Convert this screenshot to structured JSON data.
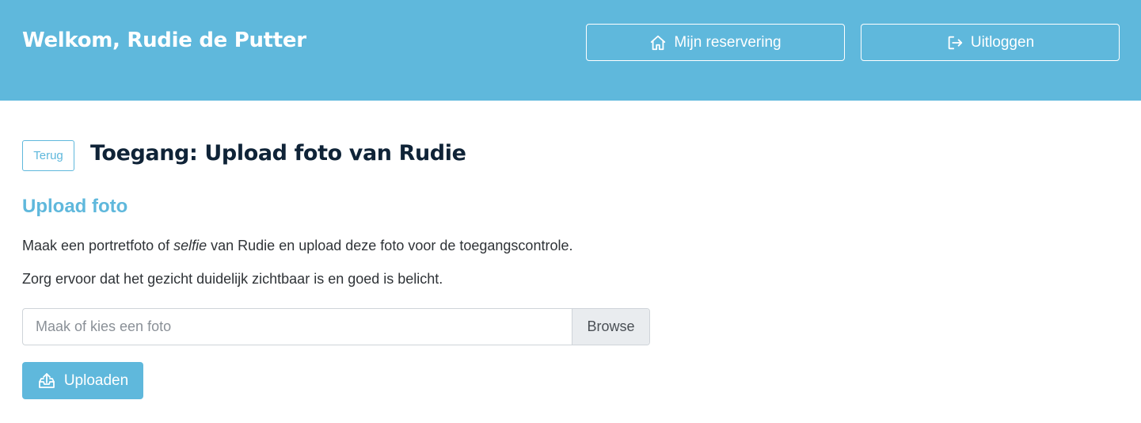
{
  "header": {
    "welcome": "Welkom, Rudie de Putter",
    "reservation_label": "Mijn reservering",
    "logout_label": "Uitloggen",
    "reservation_icon": "home-icon",
    "logout_icon": "logout-icon"
  },
  "page": {
    "back_label": "Terug",
    "title": "Toegang: Upload foto van Rudie"
  },
  "section": {
    "title": "Upload foto",
    "para1_before": "Maak een portretfoto of ",
    "para1_emphasis": "selfie",
    "para1_after": " van Rudie en upload deze foto voor de toegangscontrole.",
    "para2": "Zorg ervoor dat het gezicht duidelijk zichtbaar is en goed is belicht."
  },
  "file_input": {
    "placeholder": "Maak of kies een foto",
    "browse_label": "Browse"
  },
  "upload": {
    "label": "Uploaden",
    "icon": "upload-icon"
  },
  "colors": {
    "accent": "#5fb8dc",
    "title": "#0f2337"
  }
}
